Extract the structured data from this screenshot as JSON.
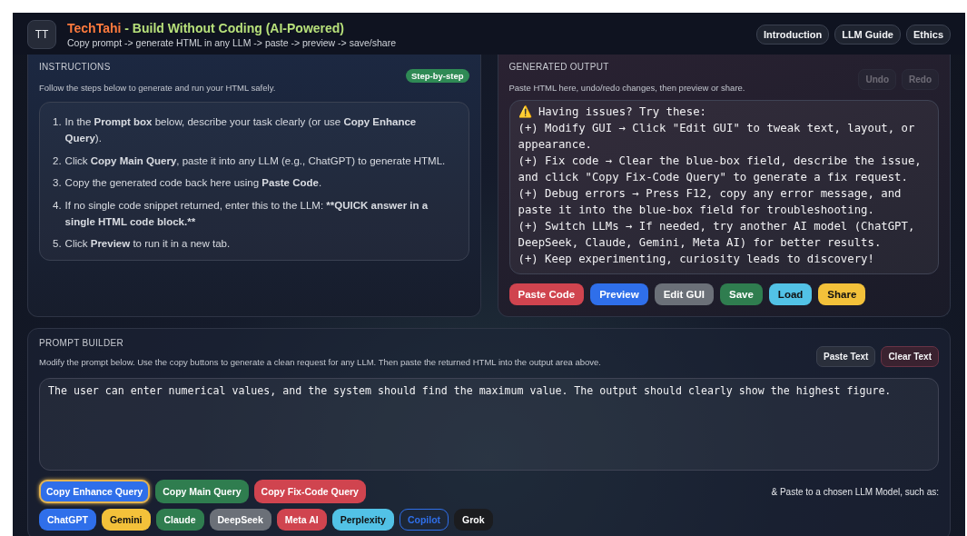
{
  "header": {
    "logo": "TT",
    "brand": "TechTahi",
    "title": " - Build Without Coding (AI-Powered)",
    "subtitle": "Copy prompt -> generate HTML in any LLM -> paste -> preview -> save/share",
    "nav": [
      "Introduction",
      "LLM Guide",
      "Ethics"
    ]
  },
  "instructions": {
    "heading": "INSTRUCTIONS",
    "badge": "Step-by-step",
    "description": "Follow the steps below to generate and run your HTML safely.",
    "steps": [
      {
        "number": "1.",
        "parts": [
          {
            "text": "In the ",
            "bold": false
          },
          {
            "text": "Prompt box",
            "bold": true
          },
          {
            "text": " below, describe your task clearly (or use ",
            "bold": false
          },
          {
            "text": "Copy Enhance Query",
            "bold": true
          },
          {
            "text": ").",
            "bold": false
          }
        ]
      },
      {
        "number": "2.",
        "parts": [
          {
            "text": "Click ",
            "bold": false
          },
          {
            "text": "Copy Main Query",
            "bold": true
          },
          {
            "text": ", paste it into any LLM (e.g., ChatGPT) to generate HTML.",
            "bold": false
          }
        ]
      },
      {
        "number": "3.",
        "parts": [
          {
            "text": "Copy the generated code back here using ",
            "bold": false
          },
          {
            "text": "Paste Code",
            "bold": true
          },
          {
            "text": ".",
            "bold": false
          }
        ]
      },
      {
        "number": "4.",
        "parts": [
          {
            "text": "If no single code snippet returned, enter this to the LLM: ",
            "bold": false
          },
          {
            "text": "**QUICK answer in a single HTML code block.**",
            "bold": true
          }
        ]
      },
      {
        "number": "5.",
        "parts": [
          {
            "text": "Click ",
            "bold": false
          },
          {
            "text": "Preview",
            "bold": true
          },
          {
            "text": " to run it in a new tab.",
            "bold": false
          }
        ]
      }
    ]
  },
  "output": {
    "heading": "GENERATED OUTPUT",
    "description": "Paste HTML here, undo/redo changes, then preview or share.",
    "history_buttons": [
      {
        "label": "Undo",
        "disabled": true
      },
      {
        "label": "Redo",
        "disabled": true
      }
    ],
    "text": "⚠️ Having issues? Try these:\n(+) Modify GUI → Click \"Edit GUI\" to tweak text, layout, or appearance.\n(+) Fix code → Clear the blue-box field, describe the issue, and click \"Copy Fix-Code Query\" to generate a fix request.\n(+) Debug errors → Press F12, copy any error message, and paste it into the blue-box field for troubleshooting.\n(+) Switch LLMs → If needed, try another AI model (ChatGPT, DeepSeek, Claude, Gemini, Meta AI) for better results.\n(+) Keep experimenting, curiosity leads to discovery!",
    "actions": [
      {
        "label": "Paste Code",
        "color": "#d0444f"
      },
      {
        "label": "Preview",
        "color": "#2f6fea"
      },
      {
        "label": "Edit GUI",
        "color": "#6b7078"
      },
      {
        "label": "Save",
        "color": "#2f7d4f"
      },
      {
        "label": "Load",
        "color": "#52c2e6"
      },
      {
        "label": "Share",
        "color": "#f3c13a"
      }
    ]
  },
  "prompt_builder": {
    "heading": "PROMPT BUILDER",
    "description": "Modify the prompt below. Use the copy buttons to generate a clean request for any LLM. Then paste the returned HTML into the output area above.",
    "text_buttons": [
      {
        "label": "Paste Text",
        "kind": "neutral"
      },
      {
        "label": "Clear Text",
        "kind": "danger"
      }
    ],
    "prompt": "The user can enter numerical values, and the system should find the maximum value. The output should clearly show the highest figure.",
    "query_buttons": [
      {
        "label": "Copy Enhance Query",
        "color": "#2f6fea",
        "selected": true
      },
      {
        "label": "Copy Main Query",
        "color": "#2f7d4f",
        "selected": false
      },
      {
        "label": "Copy Fix-Code Query",
        "color": "#d0444f",
        "selected": false
      }
    ],
    "hint": "& Paste to a chosen LLM Model, such as:",
    "models": [
      {
        "label": "ChatGPT",
        "color": "#2f6fea",
        "kind": "filled"
      },
      {
        "label": "Gemini",
        "color": "#f3c13a",
        "kind": "filled"
      },
      {
        "label": "Claude",
        "color": "#2f7d4f",
        "kind": "filled"
      },
      {
        "label": "DeepSeek",
        "color": "#6b7078",
        "kind": "filled"
      },
      {
        "label": "Meta AI",
        "color": "#d0444f",
        "kind": "filled"
      },
      {
        "label": "Perplexity",
        "color": "#52c2e6",
        "kind": "filled"
      },
      {
        "label": "Copilot",
        "color": "#2f6fea",
        "kind": "outline"
      },
      {
        "label": "Grok",
        "color": "#1b1c1f",
        "kind": "filled"
      }
    ]
  }
}
